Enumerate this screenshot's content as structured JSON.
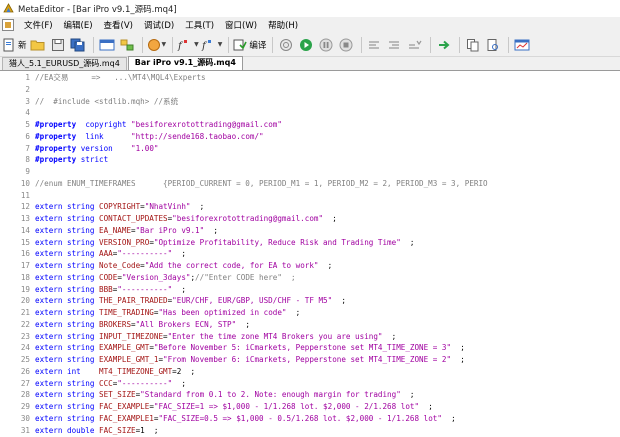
{
  "window": {
    "title": "MetaEditor - [Bar iPro v9.1_源码.mq4]"
  },
  "menu": [
    "文件(F)",
    "编辑(E)",
    "查看(V)",
    "调试(D)",
    "工具(T)",
    "窗口(W)",
    "帮助(H)"
  ],
  "toolbar": {
    "new_label": "新",
    "compile_label": "编译"
  },
  "tabs": [
    {
      "label": "猎人_5.1_EURUSD_源码.mq4",
      "active": false
    },
    {
      "label": "Bar iPro v9.1_源码.mq4",
      "active": true
    }
  ],
  "colors": {
    "comment": "#808080",
    "keyword": "#0000ff",
    "string": "#a000a0",
    "identifier": "#a31515"
  },
  "code_lines": [
    {
      "num": "1",
      "parts": [
        [
          "comment",
          "//EA交易     =>   ...\\MT4\\MQL4\\Experts"
        ]
      ]
    },
    {
      "num": "2",
      "parts": []
    },
    {
      "num": "3",
      "parts": [
        [
          "comment",
          "//  #include <stdlib.mqh> //系统"
        ]
      ]
    },
    {
      "num": "4",
      "parts": []
    },
    {
      "num": "5",
      "parts": [
        [
          "prop",
          "#property"
        ],
        [
          "txt",
          "  "
        ],
        [
          "kw",
          "copyright"
        ],
        [
          "txt",
          " "
        ],
        [
          "str",
          "\"besiforexrotottrading@gmail.com\""
        ]
      ]
    },
    {
      "num": "6",
      "parts": [
        [
          "prop",
          "#property"
        ],
        [
          "txt",
          "  "
        ],
        [
          "kw",
          "link"
        ],
        [
          "txt",
          "      "
        ],
        [
          "str",
          "\"http://sende168.taobao.com/\""
        ]
      ]
    },
    {
      "num": "7",
      "parts": [
        [
          "prop",
          "#property"
        ],
        [
          "txt",
          " "
        ],
        [
          "kw",
          "version"
        ],
        [
          "txt",
          "    "
        ],
        [
          "str",
          "\"1.00\""
        ]
      ]
    },
    {
      "num": "8",
      "parts": [
        [
          "prop",
          "#property"
        ],
        [
          "txt",
          " "
        ],
        [
          "kw",
          "strict"
        ]
      ]
    },
    {
      "num": "9",
      "parts": []
    },
    {
      "num": "10",
      "parts": [
        [
          "comment",
          "//enum ENUM_TIMEFRAMES      {PERIOD_CURRENT = 0, PERIOD_M1 = 1, PERIOD_M2 = 2, PERIOD_M3 = 3, PERIO"
        ]
      ]
    },
    {
      "num": "11",
      "parts": []
    },
    {
      "num": "12",
      "parts": [
        [
          "kw",
          "extern string "
        ],
        [
          "var",
          "COPYRIGHT"
        ],
        [
          "txt",
          "="
        ],
        [
          "str",
          "\"NhatVinh\""
        ],
        [
          "txt",
          "  ;"
        ]
      ]
    },
    {
      "num": "13",
      "parts": [
        [
          "kw",
          "extern string "
        ],
        [
          "var",
          "CONTACT_UPDATES"
        ],
        [
          "txt",
          "="
        ],
        [
          "str",
          "\"besiforexrotottrading@gmail.com\""
        ],
        [
          "txt",
          "  ;"
        ]
      ]
    },
    {
      "num": "14",
      "parts": [
        [
          "kw",
          "extern string "
        ],
        [
          "var",
          "EA_NAME"
        ],
        [
          "txt",
          "="
        ],
        [
          "str",
          "\"Bar iPro v9.1\""
        ],
        [
          "txt",
          "  ;"
        ]
      ]
    },
    {
      "num": "15",
      "parts": [
        [
          "kw",
          "extern string "
        ],
        [
          "var",
          "VERSION_PRO"
        ],
        [
          "txt",
          "="
        ],
        [
          "str",
          "\"Optimize Profitability, Reduce Risk and Trading Time\""
        ],
        [
          "txt",
          "  ;"
        ]
      ]
    },
    {
      "num": "16",
      "parts": [
        [
          "kw",
          "extern string "
        ],
        [
          "var",
          "AAA"
        ],
        [
          "txt",
          "="
        ],
        [
          "str",
          "\"----------\""
        ],
        [
          "txt",
          "  ;"
        ]
      ]
    },
    {
      "num": "17",
      "parts": [
        [
          "kw",
          "extern string "
        ],
        [
          "var",
          "Note_Code"
        ],
        [
          "txt",
          "="
        ],
        [
          "str",
          "\"Add the correct code, for EA to work\""
        ],
        [
          "txt",
          "  ;"
        ]
      ]
    },
    {
      "num": "18",
      "parts": [
        [
          "kw",
          "extern string "
        ],
        [
          "var",
          "CODE"
        ],
        [
          "txt",
          "="
        ],
        [
          "str",
          "\"Version_3days\""
        ],
        [
          "txt",
          ";"
        ],
        [
          "comment",
          "//\"Enter CODE here\"  ;"
        ]
      ]
    },
    {
      "num": "19",
      "parts": [
        [
          "kw",
          "extern string "
        ],
        [
          "var",
          "BBB"
        ],
        [
          "txt",
          "="
        ],
        [
          "str",
          "\"----------\""
        ],
        [
          "txt",
          "  ;"
        ]
      ]
    },
    {
      "num": "20",
      "parts": [
        [
          "kw",
          "extern string "
        ],
        [
          "var",
          "THE_PAIR_TRADED"
        ],
        [
          "txt",
          "="
        ],
        [
          "str",
          "\"EUR/CHF, EUR/GBP, USD/CHF - TF M5\""
        ],
        [
          "txt",
          "  ;"
        ]
      ]
    },
    {
      "num": "21",
      "parts": [
        [
          "kw",
          "extern string "
        ],
        [
          "var",
          "TIME_TRADING"
        ],
        [
          "txt",
          "="
        ],
        [
          "str",
          "\"Has been optimized in code\""
        ],
        [
          "txt",
          "  ;"
        ]
      ]
    },
    {
      "num": "22",
      "parts": [
        [
          "kw",
          "extern string "
        ],
        [
          "var",
          "BROKERS"
        ],
        [
          "txt",
          "="
        ],
        [
          "str",
          "\"All Brokers ECN, STP\""
        ],
        [
          "txt",
          "  ;"
        ]
      ]
    },
    {
      "num": "23",
      "parts": [
        [
          "kw",
          "extern string "
        ],
        [
          "var",
          "INPUT_TIMEZONE"
        ],
        [
          "txt",
          "="
        ],
        [
          "str",
          "\"Enter the time zone MT4 Brokers you are using\""
        ],
        [
          "txt",
          "  ;"
        ]
      ]
    },
    {
      "num": "24",
      "parts": [
        [
          "kw",
          "extern string "
        ],
        [
          "var",
          "EXAMPLE_GMT"
        ],
        [
          "txt",
          "="
        ],
        [
          "str",
          "\"Before November 5: iCmarkets, Pepperstone set MT4_TIME_ZONE = 3\""
        ],
        [
          "txt",
          "  ;"
        ]
      ]
    },
    {
      "num": "25",
      "parts": [
        [
          "kw",
          "extern string "
        ],
        [
          "var",
          "EXAMPLE_GMT_1"
        ],
        [
          "txt",
          "="
        ],
        [
          "str",
          "\"From November 6: iCmarkets, Pepperstone set MT4_TIME_ZONE = 2\""
        ],
        [
          "txt",
          "  ;"
        ]
      ]
    },
    {
      "num": "26",
      "parts": [
        [
          "kw",
          "extern int    "
        ],
        [
          "var",
          "MT4_TIMEZONE_GMT"
        ],
        [
          "txt",
          "=2  ;"
        ]
      ]
    },
    {
      "num": "27",
      "parts": [
        [
          "kw",
          "extern string "
        ],
        [
          "var",
          "CCC"
        ],
        [
          "txt",
          "="
        ],
        [
          "str",
          "\"----------\""
        ],
        [
          "txt",
          "  ;"
        ]
      ]
    },
    {
      "num": "28",
      "parts": [
        [
          "kw",
          "extern string "
        ],
        [
          "var",
          "SET_SIZE"
        ],
        [
          "txt",
          "="
        ],
        [
          "str",
          "\"Standard from 0.1 to 2. Note: enough margin for trading\""
        ],
        [
          "txt",
          "  ;"
        ]
      ]
    },
    {
      "num": "29",
      "parts": [
        [
          "kw",
          "extern string "
        ],
        [
          "var",
          "FAC_EXAMPLE"
        ],
        [
          "txt",
          "="
        ],
        [
          "str",
          "\"FAC_SIZE=1 => $1,000 - 1/1.268 lot. $2,000 - 2/1.268 lot\""
        ],
        [
          "txt",
          "  ;"
        ]
      ]
    },
    {
      "num": "30",
      "parts": [
        [
          "kw",
          "extern string "
        ],
        [
          "var",
          "FAC_EXAMPLE1"
        ],
        [
          "txt",
          "="
        ],
        [
          "str",
          "\"FAC_SIZE=0.5 => $1,000 - 0.5/1.268 lot. $2,000 - 1/1.268 lot\""
        ],
        [
          "txt",
          "  ;"
        ]
      ]
    },
    {
      "num": "31",
      "parts": [
        [
          "kw",
          "extern double "
        ],
        [
          "var",
          "FAC_SIZE"
        ],
        [
          "txt",
          "=1  ;"
        ]
      ]
    }
  ]
}
